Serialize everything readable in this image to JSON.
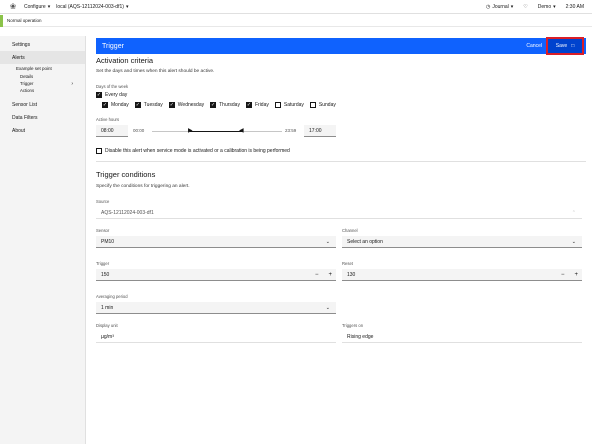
{
  "topbar": {
    "configure": "Configure",
    "device": "local (AQS-12112024-003-df1)",
    "journal": "Journal",
    "user": "Demo",
    "time": "2:30 AM"
  },
  "status": {
    "text": "Normal operation",
    "accent": "#8bc34a"
  },
  "sidebar": {
    "settings": "Settings",
    "alerts": "Alerts",
    "example": "Example set point",
    "details": "Details",
    "trigger": "Trigger",
    "actions": "Actions",
    "sensor_list": "Sensor List",
    "data_filters": "Data Filters",
    "about": "About"
  },
  "header": {
    "title": "Trigger",
    "cancel": "Cancel",
    "save": "Save",
    "color": "#0f62fe"
  },
  "activation": {
    "title": "Activation criteria",
    "desc": "Set the days and times when this alert should be active.",
    "days_label": "Days of the week",
    "every_day": "Every day",
    "days": [
      {
        "name": "Monday",
        "checked": true
      },
      {
        "name": "Tuesday",
        "checked": true
      },
      {
        "name": "Wednesday",
        "checked": true
      },
      {
        "name": "Thursday",
        "checked": true
      },
      {
        "name": "Friday",
        "checked": true
      },
      {
        "name": "Saturday",
        "checked": false
      },
      {
        "name": "Sunday",
        "checked": false
      }
    ],
    "hours_label": "Active hours",
    "start": "08:00",
    "min": "00:00",
    "max": "23:59",
    "end": "17:00",
    "service_mode": "Disable this alert when service mode is activated or a calibration is being performed"
  },
  "conditions": {
    "title": "Trigger conditions",
    "desc": "Specify the conditions for triggering an alert.",
    "source_label": "Source",
    "source": "AQS-12112024-003-df1",
    "sensor_label": "Sensor",
    "sensor": "PM10",
    "channel_label": "Channel",
    "channel": "Select an option",
    "trigger_label": "Trigger",
    "trigger": "150",
    "reset_label": "Reset",
    "reset": "130",
    "avg_label": "Averaging period",
    "avg": "1 min",
    "unit_label": "Display unit",
    "unit": "µg/m³",
    "triggers_on_label": "Triggers on",
    "triggers_on": "Rising edge"
  }
}
